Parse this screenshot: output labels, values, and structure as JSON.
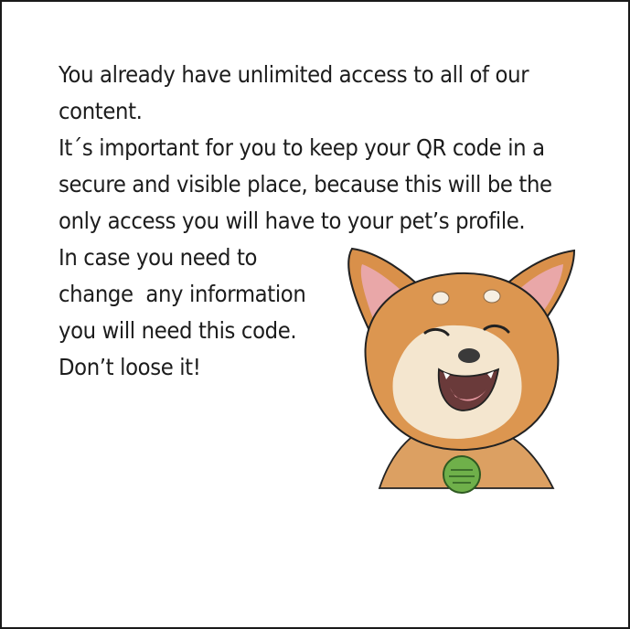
{
  "message": {
    "lines": [
      "You already have unlimited access to all of our",
      "content.",
      "It´s important for you to keep your QR code in a",
      "secure and visible place, because this will be the",
      "only access you will have to your pet’s profile.",
      "In case you need to",
      "change  any information",
      "you will need this code.",
      "Don’t loose it!"
    ]
  },
  "illustration": {
    "icon": "shiba-dog-illustration",
    "fur_color": "#d9904a",
    "collar_tag_color": "#6fb04a"
  }
}
